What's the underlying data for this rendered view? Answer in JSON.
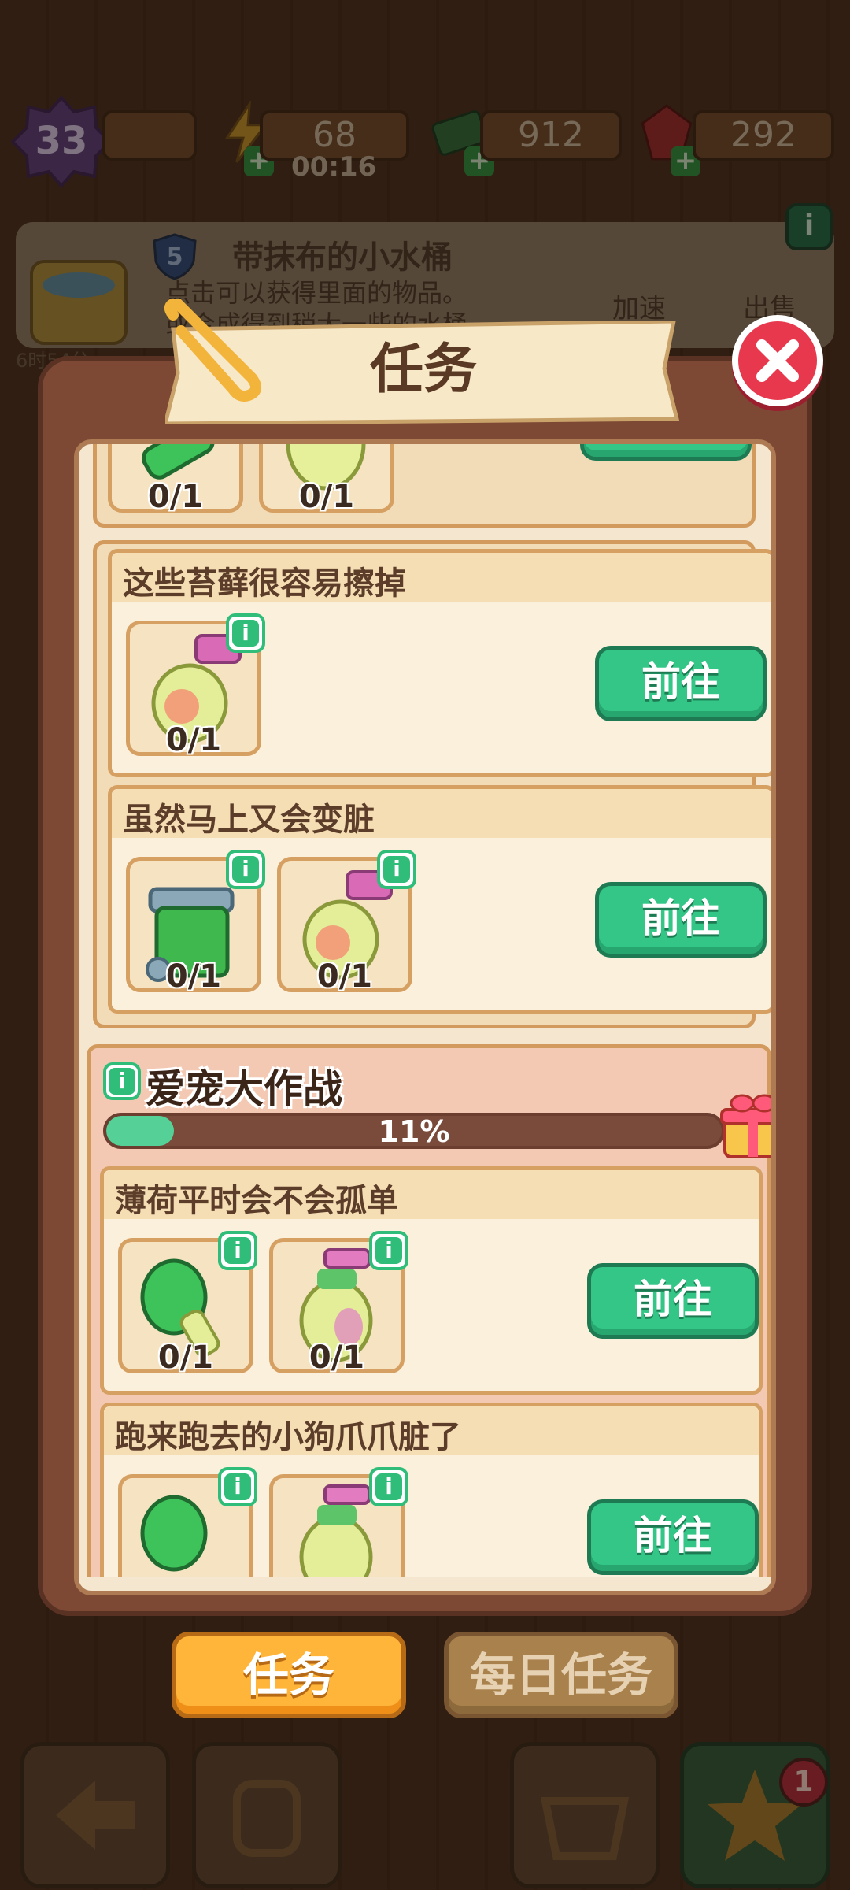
{
  "hud": {
    "level": "33",
    "energy": "68",
    "energy_timer": "00:16",
    "cash": "912",
    "gems": "292"
  },
  "item_info": {
    "level": "5",
    "title": "带抹布的小水桶",
    "desc_line1": "点击可以获得里面的物品。",
    "desc_line2": "或合成得到稍大一些的水桶",
    "speed_label": "加速",
    "sell_label": "出售",
    "timer": "6时54分"
  },
  "modal": {
    "title": "任务",
    "close_icon": "close-icon"
  },
  "tasks_top_partial": {
    "counts": [
      "0/1",
      "0/1"
    ],
    "button": "前往"
  },
  "group1": {
    "tasks": [
      {
        "title": "这些苔藓很容易擦掉",
        "items": [
          {
            "icon": "spray-bottle-icon",
            "count": "0/1"
          }
        ],
        "button": "前往"
      },
      {
        "title": "虽然马上又会变脏",
        "items": [
          {
            "icon": "trash-bin-icon",
            "count": "0/1"
          },
          {
            "icon": "spray-bottle-icon",
            "count": "0/1"
          }
        ],
        "button": "前往"
      }
    ]
  },
  "event": {
    "title": "爱宠大作战",
    "progress_text": "11%",
    "progress": 0.11,
    "tasks": [
      {
        "title": "薄荷平时会不会孤单",
        "items": [
          {
            "icon": "brush-icon",
            "count": "0/1"
          },
          {
            "icon": "shampoo-bottle-icon",
            "count": "0/1"
          }
        ],
        "button": "前往"
      },
      {
        "title": "跑来跑去的小狗爪爪脏了",
        "items": [
          {
            "icon": "brush-icon",
            "count": ""
          },
          {
            "icon": "shampoo-bottle-icon",
            "count": ""
          }
        ],
        "button": "前往"
      }
    ]
  },
  "tabs": {
    "tasks": "任务",
    "daily": "每日任务"
  },
  "bottom_badge": "1",
  "colors": {
    "go_button": "#33c686",
    "active_tab": "#ffb43a",
    "close_button": "#e8384d",
    "progress_fill": "#55d198"
  }
}
